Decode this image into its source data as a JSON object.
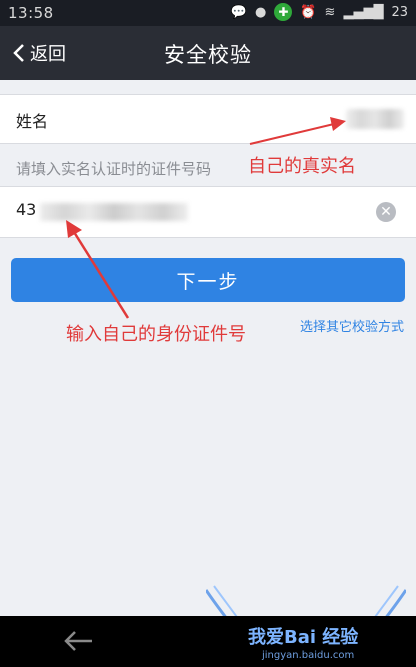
{
  "status": {
    "time": "13:58",
    "battery": "23"
  },
  "header": {
    "back_label": "返回",
    "title": "安全校验"
  },
  "form": {
    "name_label": "姓名",
    "hint": "请填入实名认证时的证件号码",
    "id_value": "43"
  },
  "actions": {
    "next_label": "下一步",
    "other_link": "选择其它校验方式"
  },
  "annotations": {
    "name_note": "自己的真实名",
    "id_note": "输入自己的身份证件号"
  },
  "watermark": {
    "text": "我爱Bai 经验",
    "sub": "jingyan.baidu.com"
  },
  "colors": {
    "accent": "#2f83e3",
    "annotation": "#e03a3a",
    "header_bg": "#2a2d35"
  }
}
